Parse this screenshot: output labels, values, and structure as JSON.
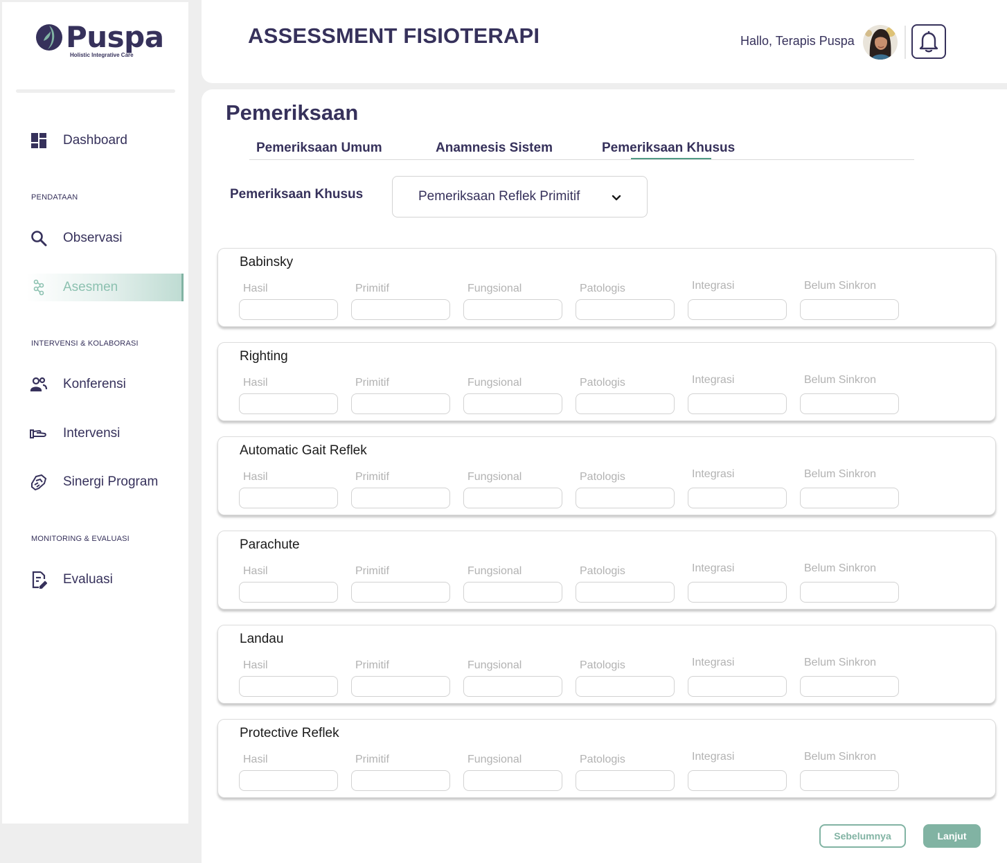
{
  "brand": {
    "name": "Puspa",
    "tagline": "Holistic Integrative Care",
    "accent": "#81b3a3",
    "primary": "#36315b"
  },
  "sidebar": {
    "dashboard": {
      "label": "Dashboard",
      "icon": "dashboard-icon"
    },
    "sections": [
      {
        "title": "PENDATAAN"
      },
      {
        "title": "INTERVENSI & KOLABORASI"
      },
      {
        "title": "MONITORING & EVALUASI"
      }
    ],
    "items": [
      {
        "label": "Observasi",
        "icon": "search-icon"
      },
      {
        "label": "Asesmen",
        "icon": "assessment-icon",
        "active": true
      },
      {
        "label": "Konferensi",
        "icon": "people-icon"
      },
      {
        "label": "Intervensi",
        "icon": "hand-icon"
      },
      {
        "label": "Sinergi Program",
        "icon": "handshake-icon"
      },
      {
        "label": "Evaluasi",
        "icon": "document-edit-icon"
      }
    ]
  },
  "header": {
    "title": "ASSESSMENT FISIOTERAPI",
    "greeting": "Hallo, Terapis Puspa"
  },
  "main": {
    "section_title": "Pemeriksaan",
    "tabs": [
      {
        "label": "Pemeriksaan Umum"
      },
      {
        "label": "Anamnesis Sistem"
      },
      {
        "label": "Pemeriksaan Khusus",
        "active": true
      }
    ],
    "select": {
      "label": "Pemeriksaan Khusus",
      "value": "Pemeriksaan Reflek Primitif"
    },
    "field_labels": [
      "Hasil",
      "Primitif",
      "Fungsional",
      "Patologis",
      "Integrasi",
      "Belum Sinkron"
    ],
    "reflexes": [
      {
        "name": "Babinsky"
      },
      {
        "name": "Righting"
      },
      {
        "name": "Automatic Gait Reflek"
      },
      {
        "name": "Parachute"
      },
      {
        "name": "Landau"
      },
      {
        "name": "Protective Reflek"
      }
    ],
    "buttons": {
      "prev": "Sebelumnya",
      "next": "Lanjut"
    }
  }
}
